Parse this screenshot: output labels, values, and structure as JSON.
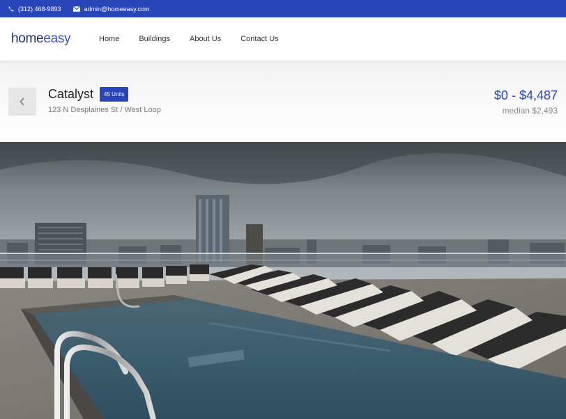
{
  "topbar": {
    "phone": "(312) 468-9893",
    "email": "admin@homeeasy.com",
    "phone_icon": "phone-icon",
    "email_icon": "envelope-icon",
    "bg_color": "#2946b8"
  },
  "logo": {
    "part1": "home",
    "part2": "easy"
  },
  "nav": {
    "items": [
      {
        "label": "Home"
      },
      {
        "label": "Buildings"
      },
      {
        "label": "About Us"
      },
      {
        "label": "Contact Us"
      }
    ]
  },
  "listing": {
    "back_icon": "chevron-left-icon",
    "name": "Catalyst",
    "units_badge": "45 Units",
    "address": "123 N Desplaines St / West Loop",
    "price_range": "$0 - $4,487",
    "median": "median $2,493",
    "accent_color": "#2946b8"
  },
  "hero": {
    "description_icon": "rooftop-pool-photo"
  }
}
